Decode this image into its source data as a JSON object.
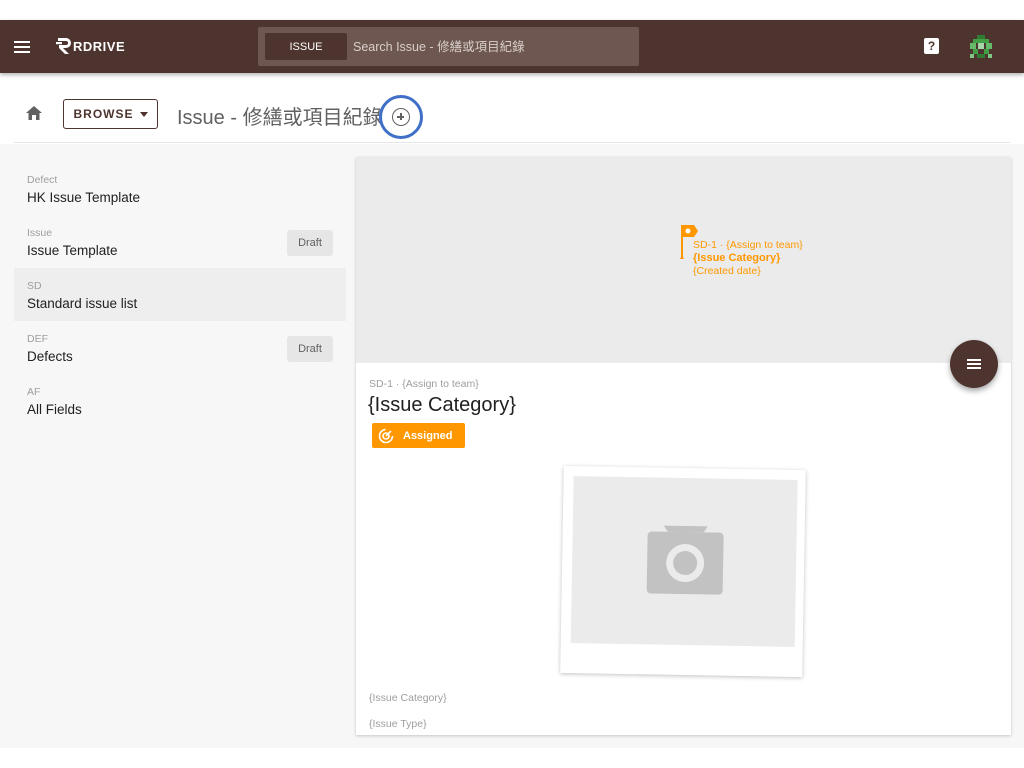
{
  "topbar": {
    "logo_text": "RDRIVE",
    "search_chip": "ISSUE",
    "search_placeholder": "Search Issue - 修繕或項目紀錄",
    "help_label": "?"
  },
  "breadcrumb": {
    "browse_label": "BROWSE",
    "title": "Issue - 修繕或項目紀錄"
  },
  "templates": [
    {
      "code": "Defect",
      "name": "HK Issue Template",
      "badge": ""
    },
    {
      "code": "Issue",
      "name": "Issue Template",
      "badge": "Draft"
    },
    {
      "code": "SD",
      "name": "Standard issue list",
      "badge": ""
    },
    {
      "code": "DEF",
      "name": "Defects",
      "badge": "Draft"
    },
    {
      "code": "AF",
      "name": "All Fields",
      "badge": ""
    }
  ],
  "card": {
    "map_label_line1": "SD-1 · {Assign to team}",
    "map_label_line2": "{Issue Category}",
    "map_label_line3": "{Created date}",
    "subtitle": "SD-1 · {Assign to team}",
    "title": "{Issue Category}",
    "status": "Assigned",
    "field_1": "{Issue Category}",
    "field_2": "{Issue Type}"
  },
  "colors": {
    "topbar": "#4e342e",
    "accent_orange": "#ff9800",
    "focus_ring": "#3f6fc7"
  },
  "icons": {
    "menu": "hamburger-icon",
    "home": "home-icon",
    "add": "add-circle-icon",
    "help": "help-icon",
    "fab": "menu-icon",
    "status": "progress-icon",
    "photo": "camera-icon",
    "map_marker": "flag-pin-icon"
  }
}
